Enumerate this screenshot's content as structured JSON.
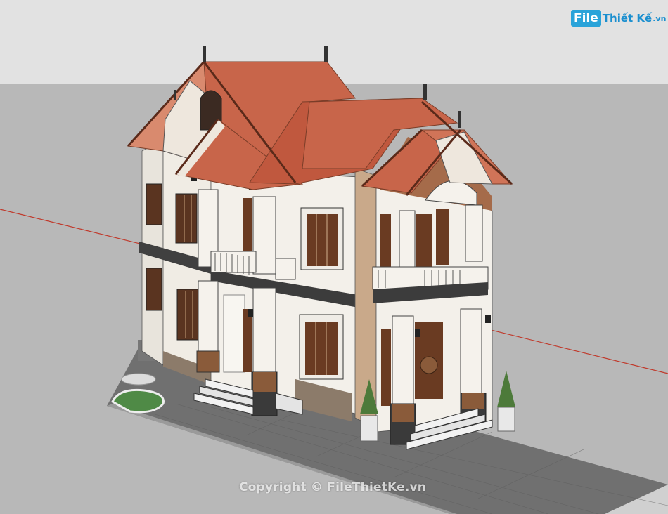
{
  "watermark": {
    "logo_box_text": "File",
    "logo_text": "Thiết Kế",
    "logo_suffix": ".vn",
    "copyright": "Copyright © FileThietKe.vn"
  },
  "colors": {
    "sky": "#dcdcdc",
    "ground": "#b6b6b6",
    "road": "#6e6e6e",
    "roof": "#c8654a",
    "wall": "#f2efe8",
    "stone_panel": "#c9a98a",
    "wood_door": "#6b3b22",
    "trim_dark": "#3c3c3c",
    "axis_red": "#c0392b",
    "grass": "#4f8a46"
  },
  "icons": [
    "filethietke-logo-icon"
  ]
}
